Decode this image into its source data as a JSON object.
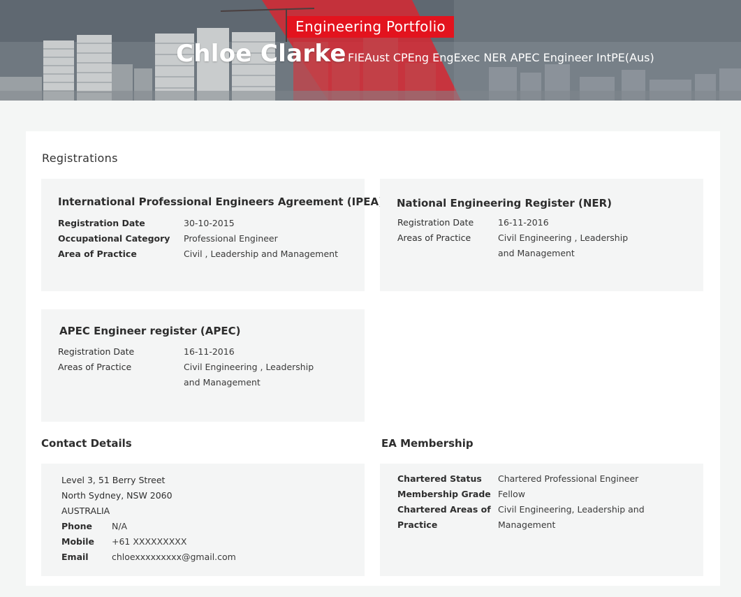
{
  "header": {
    "badge": "Engineering  Portfolio",
    "name": "Chloe Clarke",
    "qualifications": "FIEAust CPEng EngExec NER APEC Engineer IntPE(Aus)"
  },
  "registrations": {
    "heading": "Registrations",
    "ipea": {
      "title": "International Professional Engineers Agreement (IPEA)",
      "rows": [
        {
          "label": "Registration Date",
          "value": "30-10-2015"
        },
        {
          "label": "Occupational Category",
          "value": "Professional Engineer"
        },
        {
          "label": "Area of Practice",
          "value": "Civil , Leadership and Management"
        }
      ]
    },
    "ner": {
      "title": "National Engineering Register (NER)",
      "rows": [
        {
          "label": "Registration Date",
          "value": "16-11-2016"
        },
        {
          "label": "Areas of Practice",
          "value_line1": "Civil Engineering , Leadership",
          "value_line2": "and Management"
        }
      ]
    },
    "apec": {
      "title": "APEC Engineer register (APEC)",
      "rows": [
        {
          "label": "Registration Date",
          "value": "16-11-2016"
        },
        {
          "label": "Areas of Practice",
          "value_line1": "Civil Engineering , Leadership",
          "value_line2": "and Management"
        }
      ]
    }
  },
  "contact": {
    "heading": "Contact Details",
    "address_line1": "Level 3, 51 Berry Street",
    "address_line2": "North Sydney, NSW 2060",
    "address_line3": "AUSTRALIA",
    "phone_label": "Phone",
    "phone_value": "N/A",
    "mobile_label": "Mobile",
    "mobile_value": "+61 XXXXXXXXX",
    "email_label": "Email",
    "email_value": "chloexxxxxxxxx@gmail.com"
  },
  "membership": {
    "heading": "EA Membership",
    "status_label": "Chartered Status",
    "status_value": "Chartered Professional Engineer",
    "grade_label": "Membership Grade",
    "grade_value": "Fellow",
    "areas_label_line1": "Chartered Areas of",
    "areas_label_line2": "Practice",
    "areas_value_line1": "Civil Engineering, Leadership and",
    "areas_value_line2": "Management"
  },
  "colors": {
    "accent_red": "#e3131e",
    "card_bg": "#f4f5f5",
    "page_bg": "#f4f6f5"
  }
}
